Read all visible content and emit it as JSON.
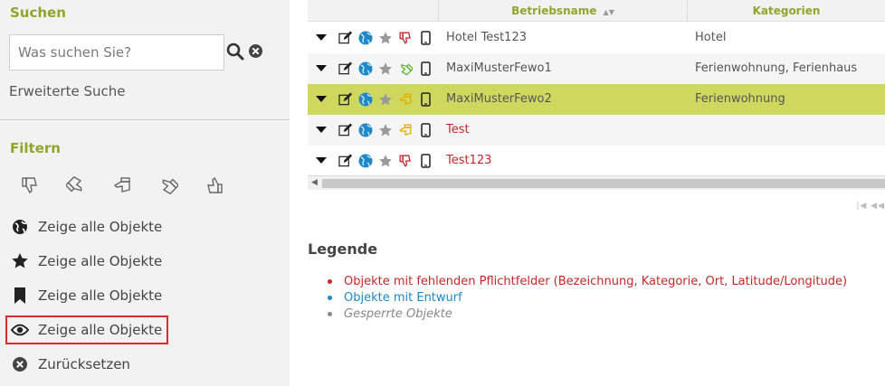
{
  "sidebar": {
    "search_heading": "Suchen",
    "search_placeholder": "Was suchen Sie?",
    "advanced_search": "Erweiterte Suche",
    "filter_heading": "Filtern",
    "filter_icons": [
      "thumbs-down-icon",
      "thumbs-tilt-down-icon",
      "thumbs-sideways-icon",
      "thumbs-tilt-up-icon",
      "thumbs-up-icon"
    ],
    "items": [
      {
        "label": "Zeige alle Objekte",
        "icon": "globe-icon"
      },
      {
        "label": "Zeige alle Objekte",
        "icon": "star-icon"
      },
      {
        "label": "Zeige alle Objekte",
        "icon": "bookmark-icon"
      },
      {
        "label": "Zeige alle Objekte",
        "icon": "eye-icon",
        "active": true
      },
      {
        "label": "Zurücksetzen",
        "icon": "reset-icon"
      }
    ]
  },
  "table": {
    "columns": [
      "Betriebsname",
      "Kategorien"
    ],
    "rows": [
      {
        "name": "Hotel Test123",
        "category": "Hotel",
        "status": "ok",
        "rating_icon": "thumbs-down-red-icon"
      },
      {
        "name": "MaxiMusterFewo1",
        "category": "Ferienwohnung, Ferienhaus",
        "status": "ok",
        "rating_icon": "thumbs-tilt-up-green-icon"
      },
      {
        "name": "MaxiMusterFewo2",
        "category": "Ferienwohnung",
        "status": "ok",
        "rating_icon": "thumbs-sideways-yellow-icon",
        "selected": true
      },
      {
        "name": "Test",
        "category": "",
        "status": "error",
        "rating_icon": "thumbs-sideways-yellow-icon"
      },
      {
        "name": "Test123",
        "category": "",
        "status": "error",
        "rating_icon": "thumbs-down-red-icon"
      }
    ]
  },
  "legend": {
    "title": "Legende",
    "items": [
      {
        "text": "Objekte mit fehlenden Pflichtfelder (Bezeichnung, Kategorie, Ort, Latitude/Longitude)",
        "color": "#c62828"
      },
      {
        "text": "Objekte mit Entwurf",
        "color": "#1e88c8"
      },
      {
        "text": "Gesperrte Objekte",
        "color": "#888888"
      }
    ]
  },
  "colors": {
    "accent": "#8ea629",
    "selected_row": "#cfd85e",
    "error_text": "#c62828",
    "draft_text": "#1e88c8"
  }
}
